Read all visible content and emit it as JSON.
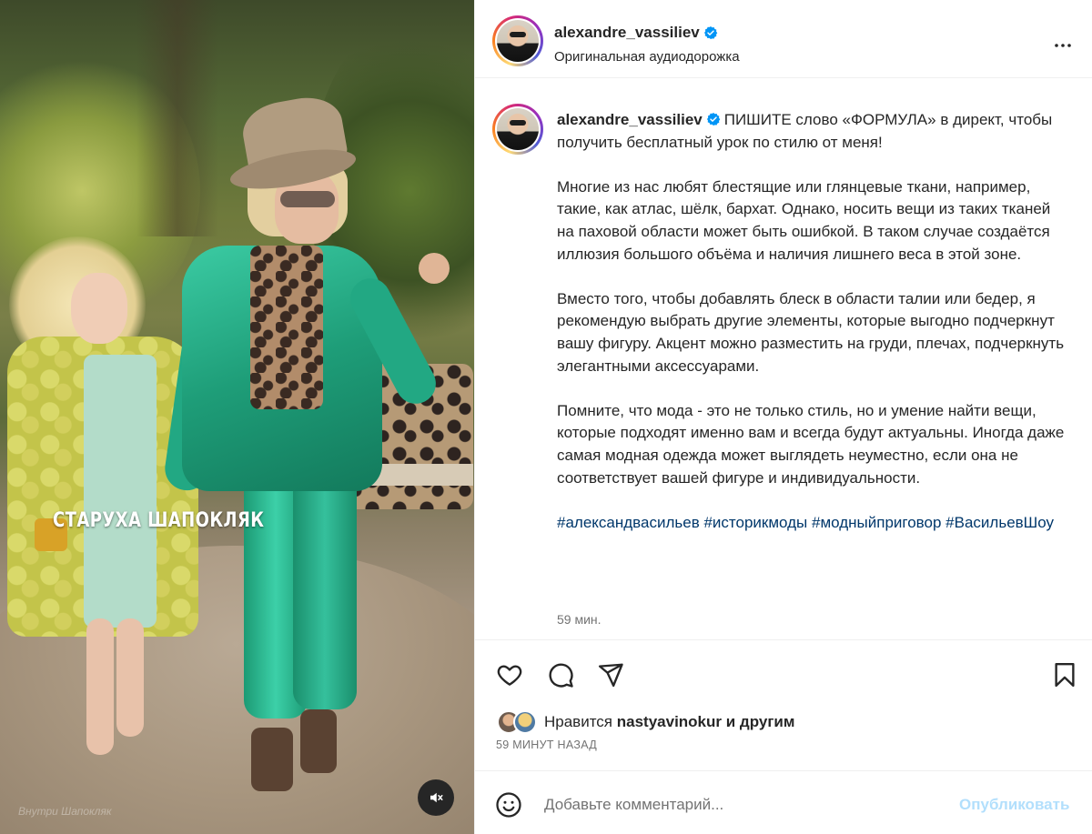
{
  "media": {
    "caption": "СТАРУХА ШАПОКЛЯК",
    "watermark": "Внутри Шапокляк",
    "mute_icon": "speaker-muted-icon"
  },
  "header": {
    "username": "alexandre_vassiliev",
    "verified_icon": "verified-badge-icon",
    "audio": "Оригинальная аудиодорожка",
    "more_icon": "more-options-icon"
  },
  "post": {
    "username": "alexandre_vassiliev",
    "caption_lead": "ПИШИТЕ слово «ФОРМУЛА» в директ, чтобы получить бесплатный урок по стилю от меня!",
    "paragraphs": [
      "Многие из нас любят блестящие или глянцевые ткани, например, такие, как атлас, шёлк, бархат. Однако, носить вещи из таких тканей на паховой области может быть ошибкой. В таком случае создаётся иллюзия большого объёма и наличия лишнего веса в этой зоне.",
      "Вместо того, чтобы добавлять блеск в области талии или бедер, я рекомендую выбрать другие элементы, которые выгодно подчеркнут вашу фигуру. Акцент можно разместить на груди, плечах, подчеркнуть элегантными аксессуарами.",
      "Помните, что мода - это не только стиль, но и умение найти вещи, которые подходят именно вам и всегда будут актуальны. Иногда даже самая модная одежда может выглядеть неуместно, если она не соответствует вашей фигуре и индивидуальности."
    ],
    "hashtags": [
      "#александвасильев",
      "#историкмоды",
      "#модныйприговор",
      "#ВасильевШоу"
    ],
    "time": "59 мин."
  },
  "actions": {
    "like_icon": "heart-icon",
    "comment_icon": "comment-icon",
    "share_icon": "share-icon",
    "save_icon": "bookmark-icon"
  },
  "likes": {
    "prefix": "Нравится",
    "user": "nastyavinokur",
    "suffix": "и другим"
  },
  "posted_ago": "59 МИНУТ НАЗАД",
  "comment": {
    "emoji_icon": "emoji-icon",
    "placeholder": "Добавьте комментарий...",
    "value": "",
    "publish_label": "Опубликовать"
  },
  "colors": {
    "link": "#00376b",
    "publish_disabled": "#b2dffc",
    "muted_text": "#737373",
    "verified": "#0095f6"
  }
}
